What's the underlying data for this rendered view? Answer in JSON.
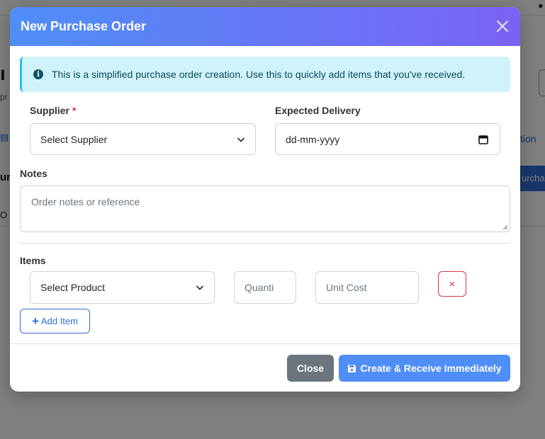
{
  "modal": {
    "title": "New Purchase Order",
    "alert_text": "This is a simplified purchase order creation. Use this to quickly add items that you've received.",
    "supplier_label": "Supplier",
    "supplier_required": "*",
    "supplier_value": "Select Supplier",
    "expected_delivery_label": "Expected Delivery",
    "expected_delivery_placeholder": "dd-mm-yyyy",
    "notes_label": "Notes",
    "notes_placeholder": "Order notes or reference",
    "items_label": "Items",
    "item_row": {
      "product_value": "Select Product",
      "quantity_placeholder": "Quanti",
      "unit_cost_placeholder": "Unit Cost",
      "remove_symbol": "×"
    },
    "add_item_label": "Add Item",
    "close_button": "Close",
    "create_button": "Create & Receive Immediately"
  },
  "background": {
    "link_right": "tion",
    "blue_button": "urchas",
    "row_text": "O"
  },
  "colors": {
    "header_gradient_start": "#4f8ef7",
    "header_gradient_end": "#7a63f4",
    "alert_bg": "#d0f3fb",
    "danger": "#dc3545",
    "primary": "#4f8ef7",
    "secondary": "#6c757d"
  },
  "icons": [
    "close-icon",
    "info-icon",
    "chevron-down-icon",
    "calendar-icon",
    "resize-grip-icon",
    "remove-icon",
    "plus-icon",
    "save-icon"
  ]
}
